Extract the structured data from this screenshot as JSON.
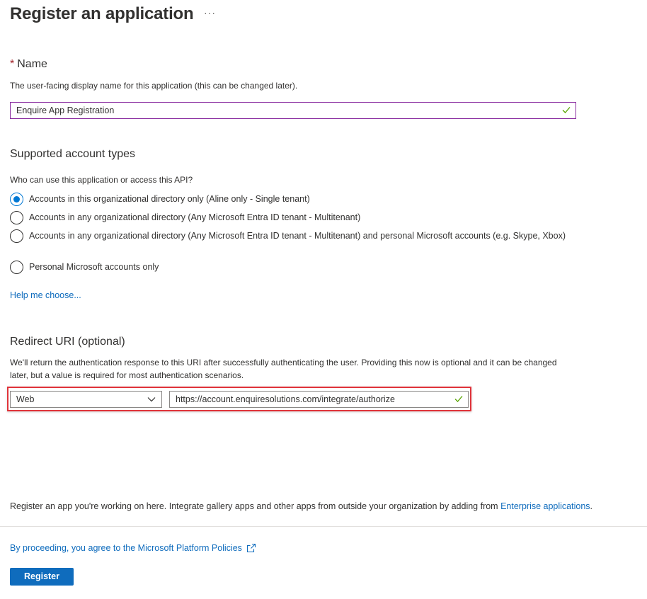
{
  "page": {
    "title": "Register an application",
    "more_label": "···"
  },
  "name_section": {
    "required_mark": "*",
    "heading": "Name",
    "description": "The user-facing display name for this application (this can be changed later).",
    "value": "Enquire App Registration"
  },
  "account_types": {
    "heading": "Supported account types",
    "question": "Who can use this application or access this API?",
    "options": [
      {
        "label": "Accounts in this organizational directory only (Aline only - Single tenant)",
        "selected": true
      },
      {
        "label": "Accounts in any organizational directory (Any Microsoft Entra ID tenant - Multitenant)",
        "selected": false
      },
      {
        "label": "Accounts in any organizational directory (Any Microsoft Entra ID tenant - Multitenant) and personal Microsoft accounts (e.g. Skype, Xbox)",
        "selected": false
      },
      {
        "label": "Personal Microsoft accounts only",
        "selected": false
      }
    ],
    "help_link": "Help me choose..."
  },
  "redirect": {
    "heading": "Redirect URI (optional)",
    "description": "We'll return the authentication response to this URI after successfully authenticating the user. Providing this now is optional and it can be changed later, but a value is required for most authentication scenarios.",
    "platform": "Web",
    "uri": "https://account.enquiresolutions.com/integrate/authorize"
  },
  "footer": {
    "note_text": "Register an app you're working on here. Integrate gallery apps and other apps from outside your organization by adding from ",
    "note_link": "Enterprise applications",
    "note_end": ".",
    "policy_link": "By proceeding, you agree to the Microsoft Platform Policies",
    "register_label": "Register"
  },
  "colors": {
    "accent": "#0f6cbd",
    "valid": "#57a300",
    "highlight": "#e0333a",
    "focus_border": "#8a2da0"
  }
}
